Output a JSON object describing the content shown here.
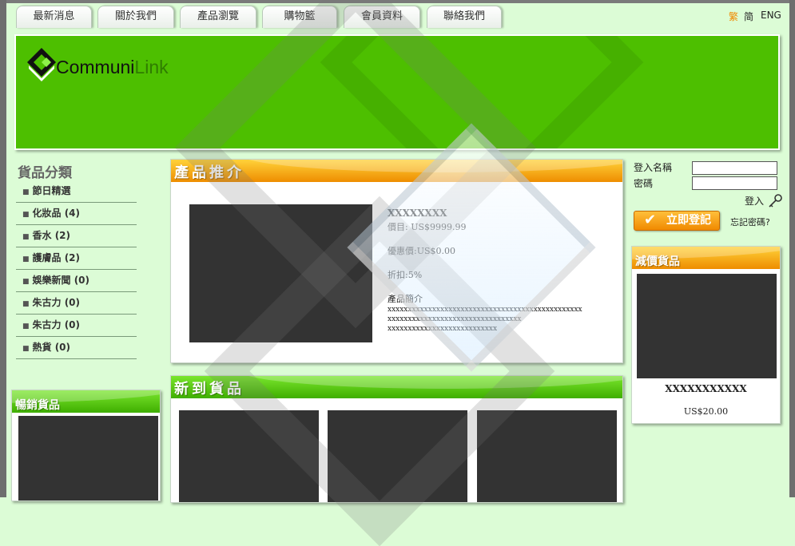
{
  "nav": {
    "tabs": [
      "最新消息",
      "關於我們",
      "產品瀏覽",
      "購物籃",
      "會員資料",
      "聯絡我們"
    ],
    "lang": [
      "繁",
      "简",
      "ENG"
    ]
  },
  "logo": {
    "part1": "Communi",
    "part2": "Link"
  },
  "categories": {
    "title": "貨品分類",
    "items": [
      "節日精選",
      "化妝品 (4)",
      "香水 (2)",
      "護膚品 (2)",
      "娛樂新聞 (0)",
      "朱古力 (0)",
      "朱古力 (0)",
      "熱貨 (0)"
    ]
  },
  "bestseller": {
    "title": "暢銷貨品"
  },
  "featured": {
    "title": "產品推介",
    "name": "XXXXXXXX",
    "price": "價目: US$9999.99",
    "discount_price": "優惠價:US$0.00",
    "discount_rate": "折扣:5%",
    "desc_title": "產品簡介",
    "desc_lines": [
      "xxxxxxxxxxxxxxxxxxxxxxxxxxxxxxxxxxxxxxxxxxxxxxxx",
      "xxxxxxxxxxxxxxxxxxxxxxxxxxxxxxxxx",
      "xxxxxxxxxxxxxxxxxxxxxxxxxxx"
    ]
  },
  "new_arrivals": {
    "title": "新到貨品"
  },
  "login": {
    "username_label": "登入名稱",
    "password_label": "密碼",
    "login_link": "登入",
    "register_button": "立即登記",
    "forgot_link": "忘記密碼?"
  },
  "sale": {
    "title": "減價貨品",
    "name": "XXXXXXXXXXX",
    "price": "US$20.00"
  },
  "colors": {
    "green": "#4dbf00",
    "orange": "#f08a00",
    "background": "#dcfcd6"
  }
}
